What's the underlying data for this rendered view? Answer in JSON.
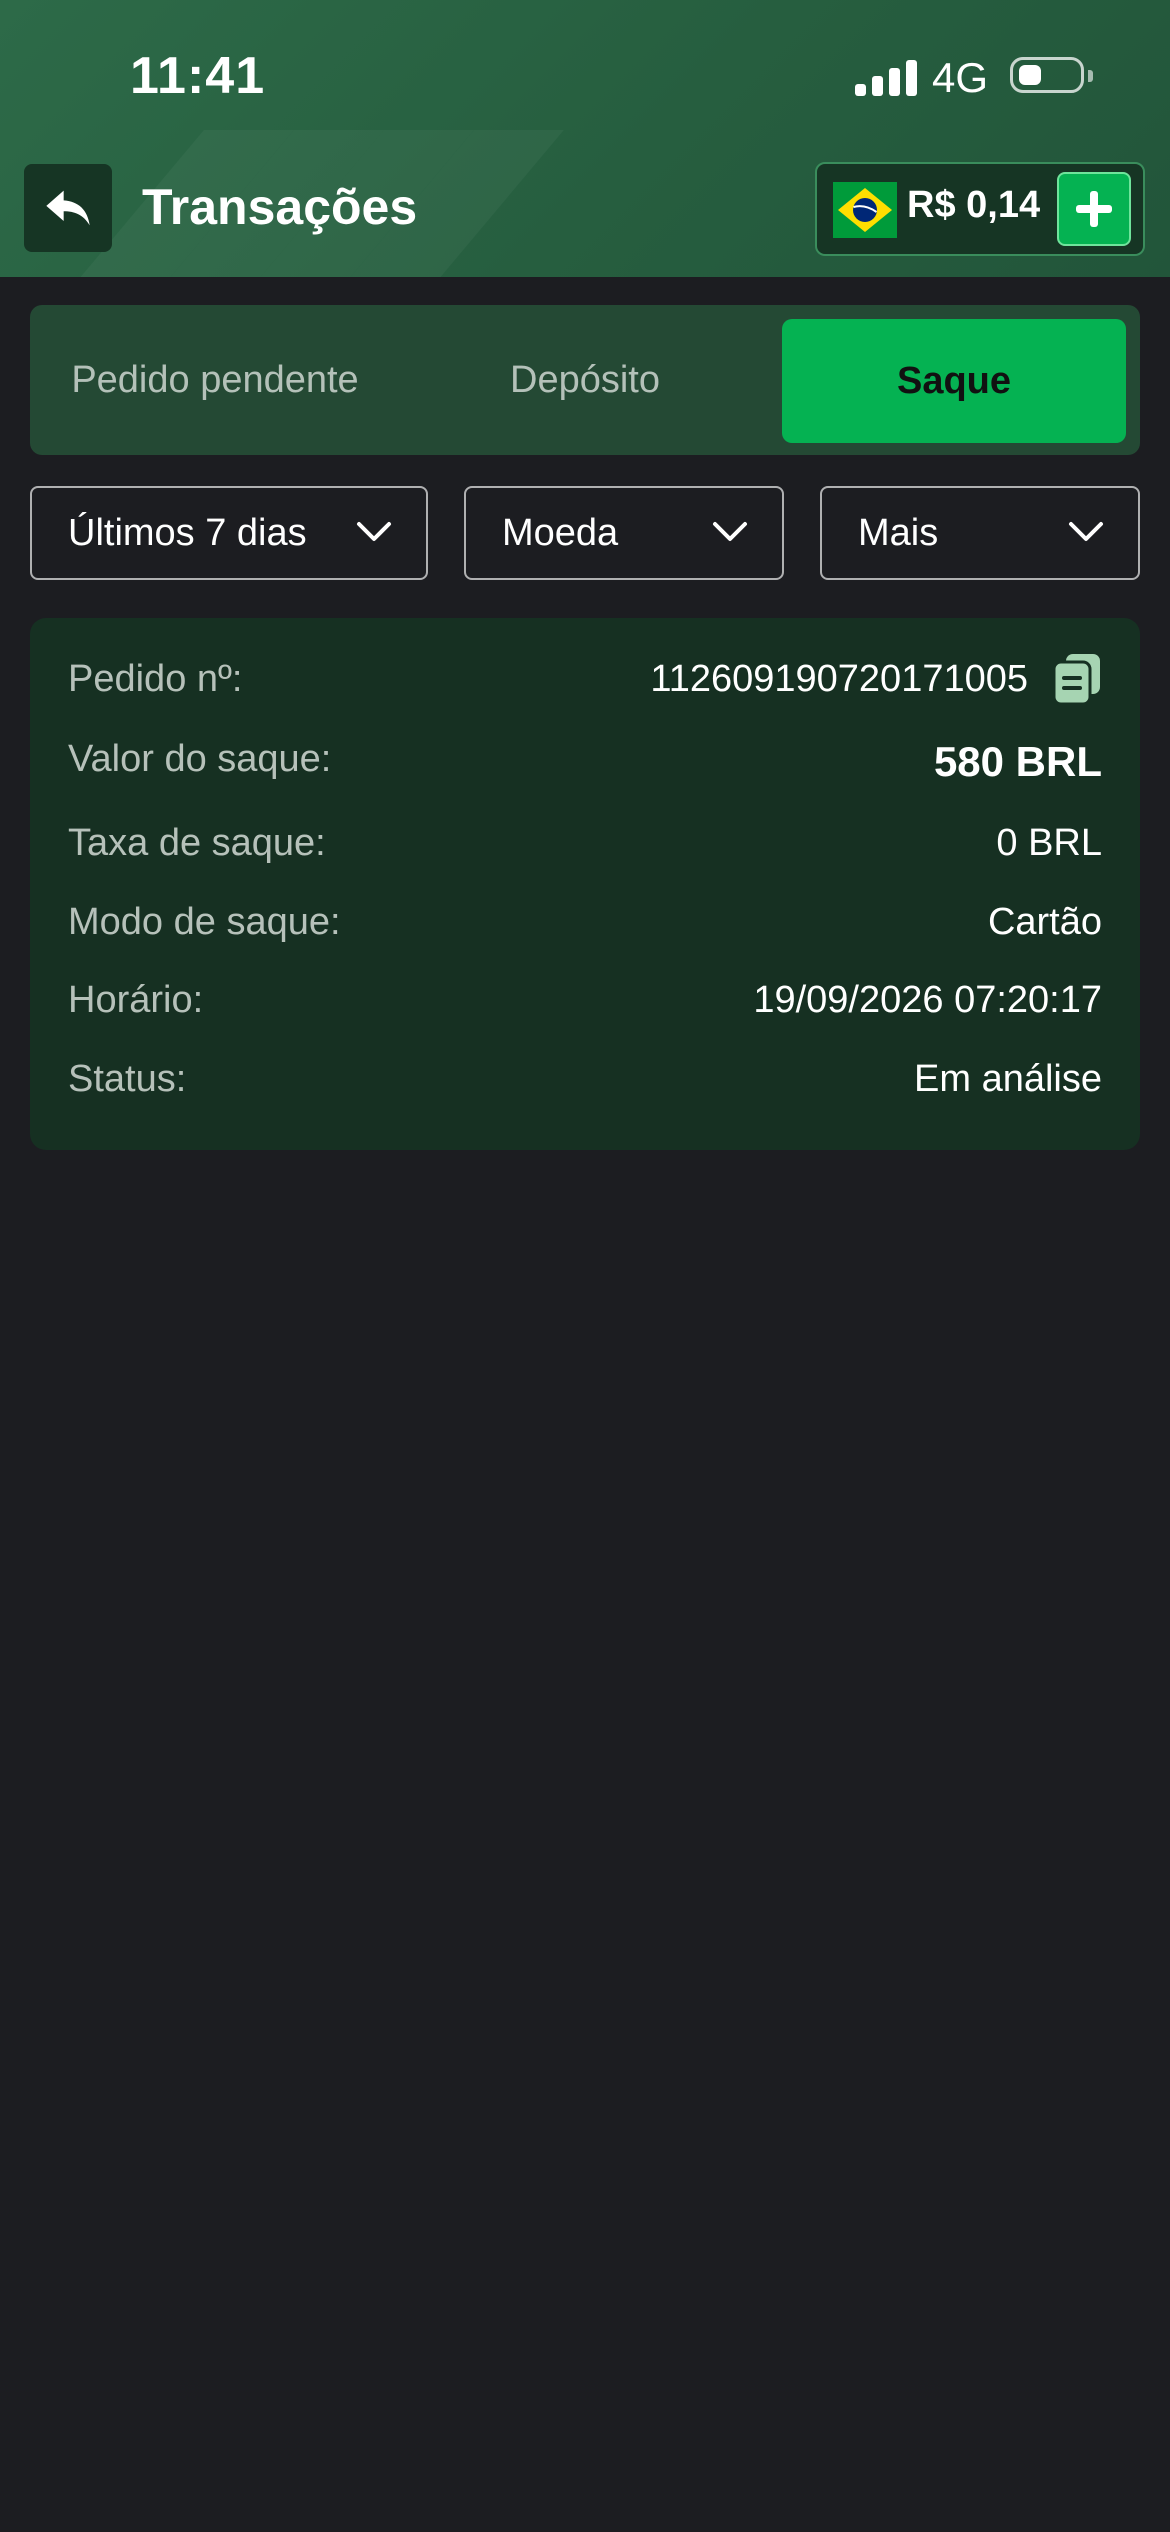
{
  "status_bar": {
    "time": "11:41",
    "network": "4G"
  },
  "header": {
    "title": "Transações",
    "balance": "R$ 0,14"
  },
  "tabs": [
    {
      "label": "Pedido pendente",
      "active": false
    },
    {
      "label": "Depósito",
      "active": false
    },
    {
      "label": "Saque",
      "active": true
    }
  ],
  "filters": {
    "period": "Últimos 7 dias",
    "currency": "Moeda",
    "more": "Mais"
  },
  "transaction": {
    "order_label": "Pedido nº:",
    "order_value": "112609190720171005",
    "amount_label": "Valor do saque:",
    "amount_value": "580 BRL",
    "fee_label": "Taxa de saque:",
    "fee_value": "0 BRL",
    "mode_label": "Modo de saque:",
    "mode_value": "Cartão",
    "time_label": "Horário:",
    "time_value": "19/09/2026 07:20:17",
    "status_label": "Status:",
    "status_value": "Em análise"
  },
  "colors": {
    "accent": "#05b252",
    "header": "#2d6a48",
    "card": "#163022",
    "background": "#1c1d21"
  },
  "icons": [
    "back-arrow-icon",
    "brazil-flag-icon",
    "plus-icon",
    "chevron-down-icon",
    "copy-icon"
  ]
}
